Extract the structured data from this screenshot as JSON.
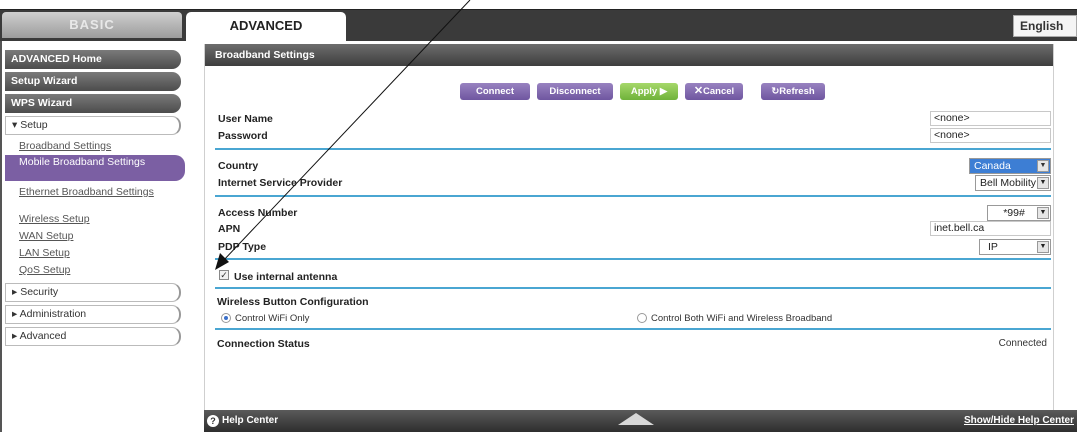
{
  "tabs": {
    "basic": "BASIC",
    "advanced": "ADVANCED"
  },
  "language": "English",
  "sidebar": {
    "dark_items": [
      "ADVANCED Home",
      "Setup Wizard",
      "WPS Wizard"
    ],
    "setup_label": "▾ Setup",
    "setup_links": [
      "Broadband Settings",
      "Mobile Broadband Settings",
      "Ethernet Broadband Settings",
      "Wireless Setup",
      "WAN Setup",
      "LAN Setup",
      "QoS Setup"
    ],
    "sections": [
      "▸ Security",
      "▸ Administration",
      "▸ Advanced"
    ]
  },
  "panel": {
    "title": "Broadband Settings",
    "buttons": {
      "connect": "Connect",
      "disconnect": "Disconnect",
      "apply": "Apply ▶",
      "cancel": "Cancel",
      "refresh": "Refresh"
    },
    "fields": {
      "user_name_label": "User Name",
      "user_name_value": "<none>",
      "password_label": "Password",
      "password_value": "<none>",
      "country_label": "Country",
      "country_value": "Canada",
      "isp_label": "Internet Service Provider",
      "isp_value": "Bell Mobility",
      "access_number_label": "Access Number",
      "access_number_value": "*99#",
      "apn_label": "APN",
      "apn_value": "inet.bell.ca",
      "pdp_label": "PDP Type",
      "pdp_value": "IP"
    },
    "antenna_label": "Use internal antenna",
    "wireless_button_title": "Wireless Button Configuration",
    "radio_wifi_only": "Control WiFi Only",
    "radio_both": "Control Both WiFi and Wireless Broadband",
    "connection_status_label": "Connection Status",
    "connection_status_value": "Connected"
  },
  "helpbar": {
    "label": "Help Center",
    "toggle": "Show/Hide Help Center"
  },
  "icons": {
    "help": "question-circle-icon",
    "cancel": "x-icon",
    "refresh": "refresh-icon",
    "expand": "triangle-up-icon"
  },
  "colors": {
    "accent_purple": "#7b5fa3",
    "apply_green": "#7fbf45",
    "separator_blue": "#4aa6d2",
    "selected_blue": "#3d7ed4"
  }
}
